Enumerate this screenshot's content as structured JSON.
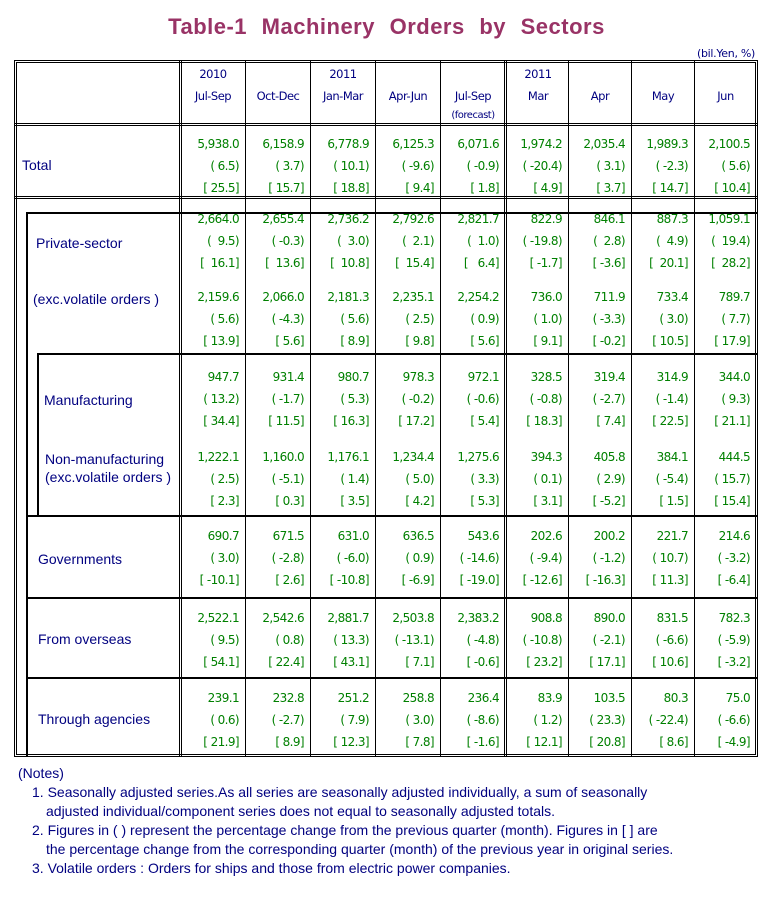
{
  "title": "Table-1   Machinery   Orders   by   Sectors",
  "unit": "(bil.Yen, %)",
  "columns": [
    {
      "l1": "2010",
      "l2": "Jul-Sep",
      "l3": ""
    },
    {
      "l1": "",
      "l2": "Oct-Dec",
      "l3": ""
    },
    {
      "l1": "2011",
      "l2": "Jan-Mar",
      "l3": ""
    },
    {
      "l1": "",
      "l2": "Apr-Jun",
      "l3": ""
    },
    {
      "l1": "",
      "l2": "Jul-Sep",
      "l3": "(forecast)"
    },
    {
      "l1": "2011",
      "l2": "Mar",
      "l3": ""
    },
    {
      "l1": "",
      "l2": "Apr",
      "l3": ""
    },
    {
      "l1": "",
      "l2": "May",
      "l3": ""
    },
    {
      "l1": "",
      "l2": "Jun",
      "l3": ""
    }
  ],
  "rows": [
    {
      "label": "Total",
      "label2": "",
      "values": [
        "5,938.0",
        "6,158.9",
        "6,778.9",
        "6,125.3",
        "6,071.6",
        "1,974.2",
        "2,035.4",
        "1,989.3",
        "2,100.5"
      ],
      "qoq": [
        "( 6.5)",
        "( 3.7)",
        "( 10.1)",
        "( -9.6)",
        "( -0.9)",
        "( -20.4)",
        "( 3.1)",
        "( -2.3)",
        "( 5.6)"
      ],
      "yoy": [
        "[ 25.5]",
        "[ 15.7]",
        "[ 18.8]",
        "[ 9.4]",
        "[ 1.8]",
        "[ 4.9]",
        "[ 3.7]",
        "[ 14.7]",
        "[ 10.4]"
      ]
    },
    {
      "label": "Private-sector",
      "label2": "",
      "values": [
        "2,664.0",
        "2,655.4",
        "2,736.2",
        "2,792.6",
        "2,821.7",
        "822.9",
        "846.1",
        "887.3",
        "1,059.1"
      ],
      "qoq": [
        "(  9.5)",
        "( -0.3)",
        "(  3.0)",
        "(  2.1)",
        "(  1.0)",
        "( -19.8)",
        "(  2.8)",
        "(  4.9)",
        "(  19.4)"
      ],
      "yoy": [
        "[  16.1]",
        "[  13.6]",
        "[  10.8]",
        "[  15.4]",
        "[   6.4]",
        "[ -1.7]",
        "[ -3.6]",
        "[  20.1]",
        "[  28.2]"
      ]
    },
    {
      "label": "(exc.volatile orders )",
      "label2": "",
      "values": [
        "2,159.6",
        "2,066.0",
        "2,181.3",
        "2,235.1",
        "2,254.2",
        "736.0",
        "711.9",
        "733.4",
        "789.7"
      ],
      "qoq": [
        "( 5.6)",
        "( -4.3)",
        "( 5.6)",
        "( 2.5)",
        "( 0.9)",
        "( 1.0)",
        "( -3.3)",
        "( 3.0)",
        "( 7.7)"
      ],
      "yoy": [
        "[ 13.9]",
        "[ 5.6]",
        "[ 8.9]",
        "[ 9.8]",
        "[ 5.6]",
        "[ 9.1]",
        "[ -0.2]",
        "[ 10.5]",
        "[ 17.9]"
      ]
    },
    {
      "label": "Manufacturing",
      "label2": "",
      "values": [
        "947.7",
        "931.4",
        "980.7",
        "978.3",
        "972.1",
        "328.5",
        "319.4",
        "314.9",
        "344.0"
      ],
      "qoq": [
        "( 13.2)",
        "( -1.7)",
        "( 5.3)",
        "( -0.2)",
        "( -0.6)",
        "( -0.8)",
        "( -2.7)",
        "( -1.4)",
        "( 9.3)"
      ],
      "yoy": [
        "[ 34.4]",
        "[ 11.5]",
        "[ 16.3]",
        "[ 17.2]",
        "[ 5.4]",
        "[ 18.3]",
        "[ 7.4]",
        "[ 22.5]",
        "[ 21.1]"
      ]
    },
    {
      "label": "Non-manufacturing",
      "label2": "(exc.volatile orders )",
      "values": [
        "1,222.1",
        "1,160.0",
        "1,176.1",
        "1,234.4",
        "1,275.6",
        "394.3",
        "405.8",
        "384.1",
        "444.5"
      ],
      "qoq": [
        "( 2.5)",
        "( -5.1)",
        "( 1.4)",
        "( 5.0)",
        "( 3.3)",
        "( 0.1)",
        "( 2.9)",
        "( -5.4)",
        "( 15.7)"
      ],
      "yoy": [
        "[ 2.3]",
        "[ 0.3]",
        "[ 3.5]",
        "[ 4.2]",
        "[ 5.3]",
        "[ 3.1]",
        "[ -5.2]",
        "[ 1.5]",
        "[ 15.4]"
      ]
    },
    {
      "label": "Governments",
      "label2": "",
      "values": [
        "690.7",
        "671.5",
        "631.0",
        "636.5",
        "543.6",
        "202.6",
        "200.2",
        "221.7",
        "214.6"
      ],
      "qoq": [
        "( 3.0)",
        "( -2.8)",
        "( -6.0)",
        "( 0.9)",
        "( -14.6)",
        "( -9.4)",
        "( -1.2)",
        "( 10.7)",
        "( -3.2)"
      ],
      "yoy": [
        "[ -10.1]",
        "[ 2.6]",
        "[ -10.8]",
        "[ -6.9]",
        "[ -19.0]",
        "[ -12.6]",
        "[ -16.3]",
        "[ 11.3]",
        "[ -6.4]"
      ]
    },
    {
      "label": "From overseas",
      "label2": "",
      "values": [
        "2,522.1",
        "2,542.6",
        "2,881.7",
        "2,503.8",
        "2,383.2",
        "908.8",
        "890.0",
        "831.5",
        "782.3"
      ],
      "qoq": [
        "( 9.5)",
        "( 0.8)",
        "( 13.3)",
        "( -13.1)",
        "( -4.8)",
        "( -10.8)",
        "( -2.1)",
        "( -6.6)",
        "( -5.9)"
      ],
      "yoy": [
        "[ 54.1]",
        "[ 22.4]",
        "[ 43.1]",
        "[ 7.1]",
        "[ -0.6]",
        "[ 23.2]",
        "[ 17.1]",
        "[ 10.6]",
        "[ -3.2]"
      ]
    },
    {
      "label": "Through agencies",
      "label2": "",
      "values": [
        "239.1",
        "232.8",
        "251.2",
        "258.8",
        "236.4",
        "83.9",
        "103.5",
        "80.3",
        "75.0"
      ],
      "qoq": [
        "( 0.6)",
        "( -2.7)",
        "( 7.9)",
        "( 3.0)",
        "( -8.6)",
        "( 1.2)",
        "( 23.3)",
        "( -22.4)",
        "( -6.6)"
      ],
      "yoy": [
        "[ 21.9]",
        "[ 8.9]",
        "[ 12.3]",
        "[ 7.8]",
        "[ -1.6]",
        "[ 12.1]",
        "[ 20.8]",
        "[ 8.6]",
        "[ -4.9]"
      ]
    }
  ],
  "notes": {
    "heading": "(Notes)",
    "n1a": "1. Seasonally adjusted series.As all series are seasonally adjusted individually, a sum of seasonally",
    "n1b": "adjusted individual/component series does not equal to seasonally adjusted totals.",
    "n2a": "2. Figures in ( ) represent the percentage change from the previous quarter (month). Figures in [ ] are",
    "n2b": "the percentage change from the corresponding quarter (month) of the previous year in original series.",
    "n3": "3. Volatile orders : Orders for ships and those from electric power companies."
  }
}
